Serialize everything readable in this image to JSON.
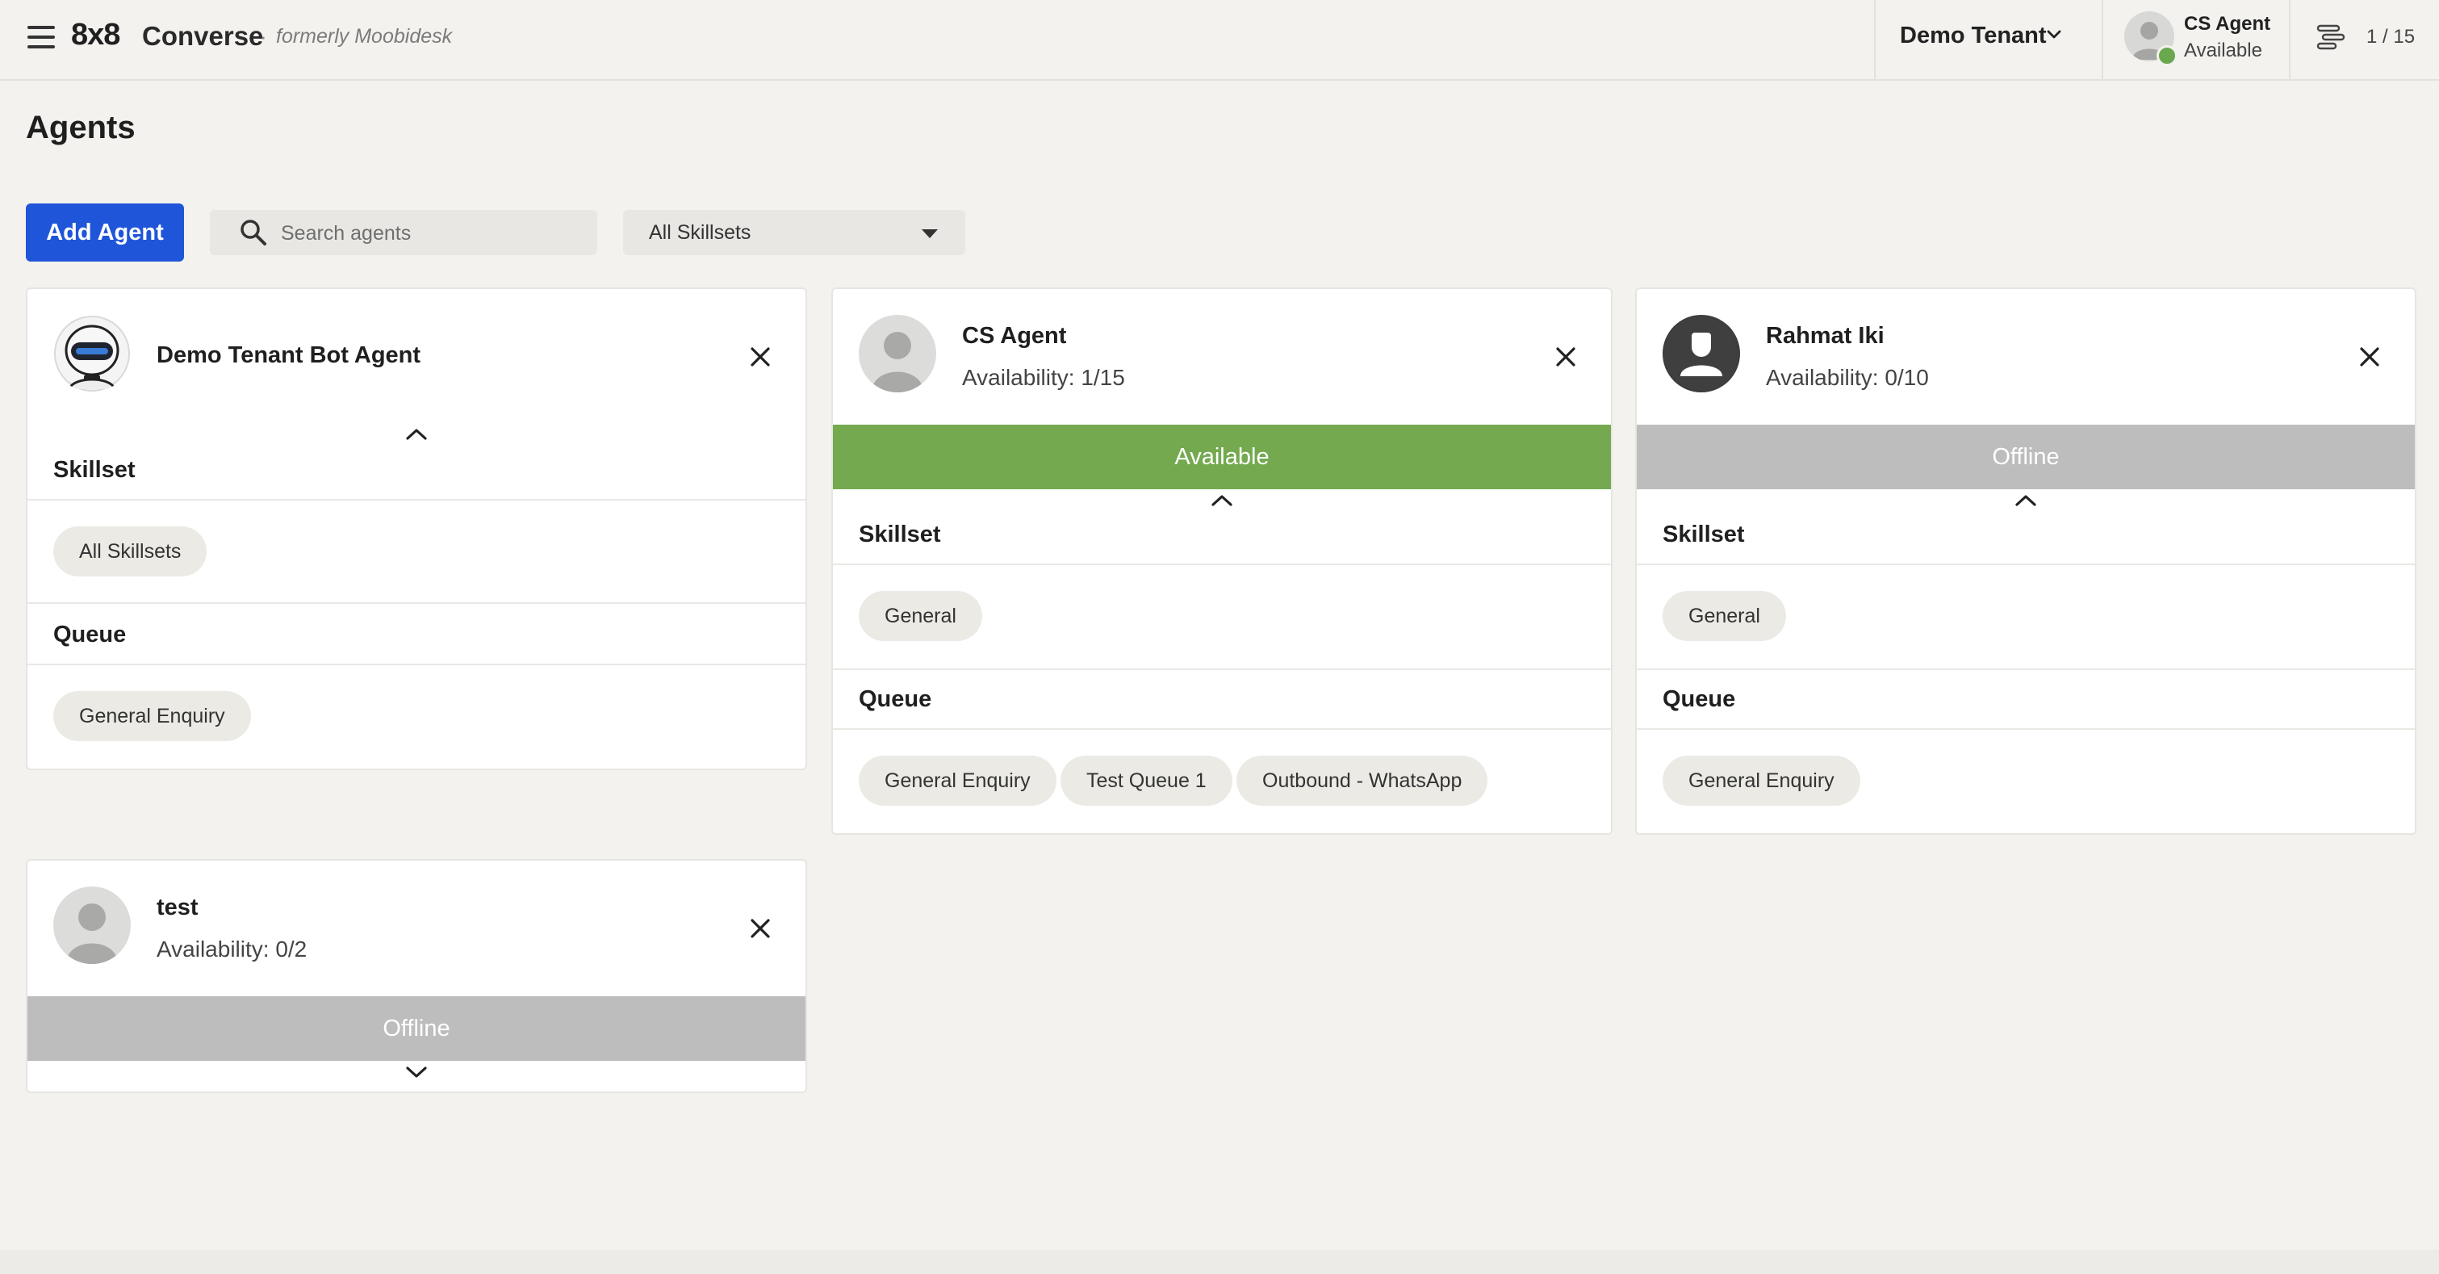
{
  "header": {
    "brand_8x8": "8x8",
    "brand_product": "Converse",
    "brand_separator": "·",
    "brand_formerly": "formerly Moobidesk",
    "tenant": "Demo Tenant",
    "user_name": "CS Agent",
    "user_status": "Available",
    "queue_count": "1 / 15"
  },
  "page": {
    "title": "Agents",
    "add_button": "Add Agent",
    "search_placeholder": "Search agents",
    "skillset_filter": "All Skillsets"
  },
  "labels": {
    "skillset": "Skillset",
    "queue": "Queue"
  },
  "agents": [
    {
      "name": "Demo Tenant Bot Agent",
      "availability": "",
      "status": "",
      "skillsets": [
        "All Skillsets"
      ],
      "queues": [
        "General Enquiry"
      ],
      "expanded": true
    },
    {
      "name": "CS Agent",
      "availability": "Availability: 1/15",
      "status": "Available",
      "skillsets": [
        "General"
      ],
      "queues": [
        "General Enquiry",
        "Test Queue 1",
        "Outbound - WhatsApp"
      ],
      "expanded": true
    },
    {
      "name": "Rahmat Iki",
      "availability": "Availability: 0/10",
      "status": "Offline",
      "skillsets": [
        "General"
      ],
      "queues": [
        "General Enquiry"
      ],
      "expanded": true
    },
    {
      "name": "test",
      "availability": "Availability: 0/2",
      "status": "Offline",
      "skillsets": [],
      "queues": [],
      "expanded": false
    }
  ],
  "colors": {
    "primary": "#1f56d9",
    "available": "#74a94f",
    "offline": "#bdbdbd",
    "background": "#f3f2ef"
  },
  "icons": [
    "menu-icon",
    "chevron-down-icon",
    "search-icon",
    "caret-down-icon",
    "close-icon",
    "chevron-up-icon",
    "queue-list-icon",
    "bot-icon",
    "user-icon"
  ]
}
